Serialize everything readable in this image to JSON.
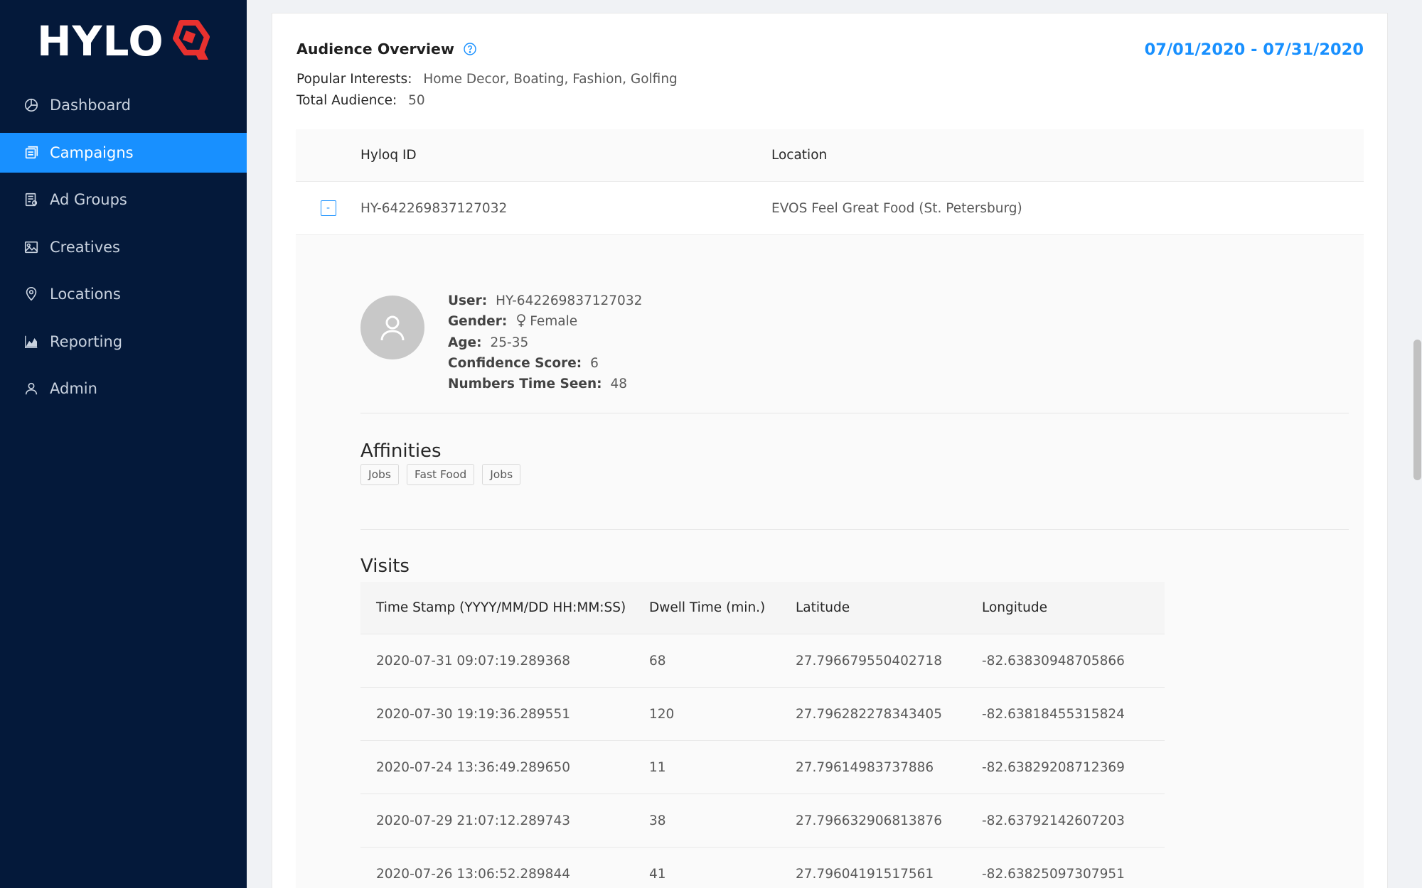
{
  "brand": {
    "logo_text": "HYLO"
  },
  "sidebar": {
    "items": [
      {
        "label": "Dashboard",
        "icon": "pie-chart-icon"
      },
      {
        "label": "Campaigns",
        "icon": "campaigns-icon",
        "active": true
      },
      {
        "label": "Ad Groups",
        "icon": "ad-groups-icon"
      },
      {
        "label": "Creatives",
        "icon": "image-icon"
      },
      {
        "label": "Locations",
        "icon": "location-pin-icon"
      },
      {
        "label": "Reporting",
        "icon": "area-chart-icon"
      },
      {
        "label": "Admin",
        "icon": "user-icon"
      }
    ]
  },
  "overview": {
    "title": "Audience Overview",
    "date_range": "07/01/2020 - 07/31/2020",
    "popular_interests_label": "Popular Interests",
    "popular_interests_value": "Home Decor, Boating, Fashion, Golfing",
    "total_audience_label": "Total Audience",
    "total_audience_value": "50"
  },
  "audience_table": {
    "headers": {
      "id": "Hyloq ID",
      "location": "Location"
    },
    "row": {
      "id": "HY-642269837127032",
      "location": "EVOS Feel Great Food (St. Petersburg)",
      "collapse_symbol": "-"
    }
  },
  "user_detail": {
    "user_label": "User:",
    "user_value": "HY-642269837127032",
    "gender_label": "Gender:",
    "gender_value": "Female",
    "age_label": "Age:",
    "age_value": "25-35",
    "confidence_label": "Confidence Score:",
    "confidence_value": "6",
    "seen_label": "Numbers Time Seen:",
    "seen_value": "48"
  },
  "affinities": {
    "title": "Affinities",
    "tags": [
      "Jobs",
      "Fast Food",
      "Jobs"
    ]
  },
  "visits": {
    "title": "Visits",
    "headers": {
      "timestamp": "Time Stamp (YYYY/MM/DD HH:MM:SS)",
      "dwell": "Dwell Time (min.)",
      "latitude": "Latitude",
      "longitude": "Longitude"
    },
    "rows": [
      {
        "timestamp": "2020-07-31 09:07:19.289368",
        "dwell": "68",
        "latitude": "27.796679550402718",
        "longitude": "-82.63830948705866"
      },
      {
        "timestamp": "2020-07-30 19:19:36.289551",
        "dwell": "120",
        "latitude": "27.796282278343405",
        "longitude": "-82.63818455315824"
      },
      {
        "timestamp": "2020-07-24 13:36:49.289650",
        "dwell": "11",
        "latitude": "27.79614983737886",
        "longitude": "-82.63829208712369"
      },
      {
        "timestamp": "2020-07-29 21:07:12.289743",
        "dwell": "38",
        "latitude": "27.796632906813876",
        "longitude": "-82.63792142607203"
      },
      {
        "timestamp": "2020-07-26 13:06:52.289844",
        "dwell": "41",
        "latitude": "27.79604191517561",
        "longitude": "-82.63825097307951"
      }
    ]
  },
  "colors": {
    "sidebar_bg": "#04193a",
    "accent": "#1890ff",
    "logo_red": "#e8312f"
  }
}
